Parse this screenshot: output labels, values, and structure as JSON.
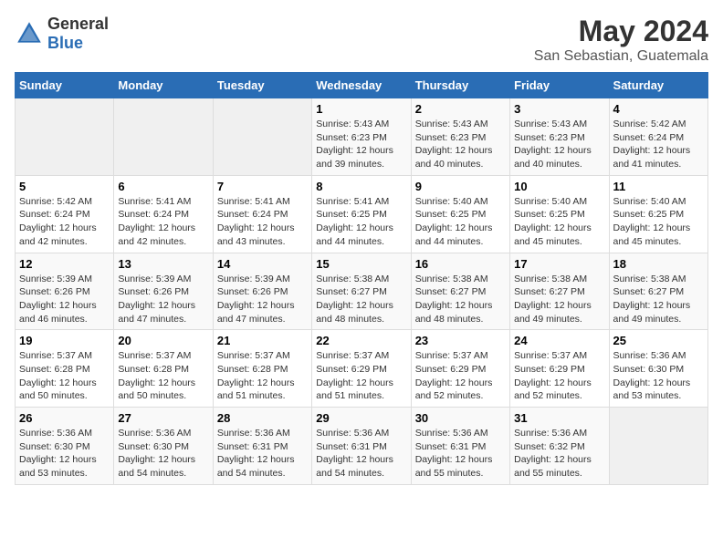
{
  "logo": {
    "general": "General",
    "blue": "Blue"
  },
  "title": "May 2024",
  "subtitle": "San Sebastian, Guatemala",
  "days_of_week": [
    "Sunday",
    "Monday",
    "Tuesday",
    "Wednesday",
    "Thursday",
    "Friday",
    "Saturday"
  ],
  "weeks": [
    [
      {
        "day": "",
        "info": ""
      },
      {
        "day": "",
        "info": ""
      },
      {
        "day": "",
        "info": ""
      },
      {
        "day": "1",
        "info": "Sunrise: 5:43 AM\nSunset: 6:23 PM\nDaylight: 12 hours\nand 39 minutes."
      },
      {
        "day": "2",
        "info": "Sunrise: 5:43 AM\nSunset: 6:23 PM\nDaylight: 12 hours\nand 40 minutes."
      },
      {
        "day": "3",
        "info": "Sunrise: 5:43 AM\nSunset: 6:23 PM\nDaylight: 12 hours\nand 40 minutes."
      },
      {
        "day": "4",
        "info": "Sunrise: 5:42 AM\nSunset: 6:24 PM\nDaylight: 12 hours\nand 41 minutes."
      }
    ],
    [
      {
        "day": "5",
        "info": "Sunrise: 5:42 AM\nSunset: 6:24 PM\nDaylight: 12 hours\nand 42 minutes."
      },
      {
        "day": "6",
        "info": "Sunrise: 5:41 AM\nSunset: 6:24 PM\nDaylight: 12 hours\nand 42 minutes."
      },
      {
        "day": "7",
        "info": "Sunrise: 5:41 AM\nSunset: 6:24 PM\nDaylight: 12 hours\nand 43 minutes."
      },
      {
        "day": "8",
        "info": "Sunrise: 5:41 AM\nSunset: 6:25 PM\nDaylight: 12 hours\nand 44 minutes."
      },
      {
        "day": "9",
        "info": "Sunrise: 5:40 AM\nSunset: 6:25 PM\nDaylight: 12 hours\nand 44 minutes."
      },
      {
        "day": "10",
        "info": "Sunrise: 5:40 AM\nSunset: 6:25 PM\nDaylight: 12 hours\nand 45 minutes."
      },
      {
        "day": "11",
        "info": "Sunrise: 5:40 AM\nSunset: 6:25 PM\nDaylight: 12 hours\nand 45 minutes."
      }
    ],
    [
      {
        "day": "12",
        "info": "Sunrise: 5:39 AM\nSunset: 6:26 PM\nDaylight: 12 hours\nand 46 minutes."
      },
      {
        "day": "13",
        "info": "Sunrise: 5:39 AM\nSunset: 6:26 PM\nDaylight: 12 hours\nand 47 minutes."
      },
      {
        "day": "14",
        "info": "Sunrise: 5:39 AM\nSunset: 6:26 PM\nDaylight: 12 hours\nand 47 minutes."
      },
      {
        "day": "15",
        "info": "Sunrise: 5:38 AM\nSunset: 6:27 PM\nDaylight: 12 hours\nand 48 minutes."
      },
      {
        "day": "16",
        "info": "Sunrise: 5:38 AM\nSunset: 6:27 PM\nDaylight: 12 hours\nand 48 minutes."
      },
      {
        "day": "17",
        "info": "Sunrise: 5:38 AM\nSunset: 6:27 PM\nDaylight: 12 hours\nand 49 minutes."
      },
      {
        "day": "18",
        "info": "Sunrise: 5:38 AM\nSunset: 6:27 PM\nDaylight: 12 hours\nand 49 minutes."
      }
    ],
    [
      {
        "day": "19",
        "info": "Sunrise: 5:37 AM\nSunset: 6:28 PM\nDaylight: 12 hours\nand 50 minutes."
      },
      {
        "day": "20",
        "info": "Sunrise: 5:37 AM\nSunset: 6:28 PM\nDaylight: 12 hours\nand 50 minutes."
      },
      {
        "day": "21",
        "info": "Sunrise: 5:37 AM\nSunset: 6:28 PM\nDaylight: 12 hours\nand 51 minutes."
      },
      {
        "day": "22",
        "info": "Sunrise: 5:37 AM\nSunset: 6:29 PM\nDaylight: 12 hours\nand 51 minutes."
      },
      {
        "day": "23",
        "info": "Sunrise: 5:37 AM\nSunset: 6:29 PM\nDaylight: 12 hours\nand 52 minutes."
      },
      {
        "day": "24",
        "info": "Sunrise: 5:37 AM\nSunset: 6:29 PM\nDaylight: 12 hours\nand 52 minutes."
      },
      {
        "day": "25",
        "info": "Sunrise: 5:36 AM\nSunset: 6:30 PM\nDaylight: 12 hours\nand 53 minutes."
      }
    ],
    [
      {
        "day": "26",
        "info": "Sunrise: 5:36 AM\nSunset: 6:30 PM\nDaylight: 12 hours\nand 53 minutes."
      },
      {
        "day": "27",
        "info": "Sunrise: 5:36 AM\nSunset: 6:30 PM\nDaylight: 12 hours\nand 54 minutes."
      },
      {
        "day": "28",
        "info": "Sunrise: 5:36 AM\nSunset: 6:31 PM\nDaylight: 12 hours\nand 54 minutes."
      },
      {
        "day": "29",
        "info": "Sunrise: 5:36 AM\nSunset: 6:31 PM\nDaylight: 12 hours\nand 54 minutes."
      },
      {
        "day": "30",
        "info": "Sunrise: 5:36 AM\nSunset: 6:31 PM\nDaylight: 12 hours\nand 55 minutes."
      },
      {
        "day": "31",
        "info": "Sunrise: 5:36 AM\nSunset: 6:32 PM\nDaylight: 12 hours\nand 55 minutes."
      },
      {
        "day": "",
        "info": ""
      }
    ]
  ]
}
